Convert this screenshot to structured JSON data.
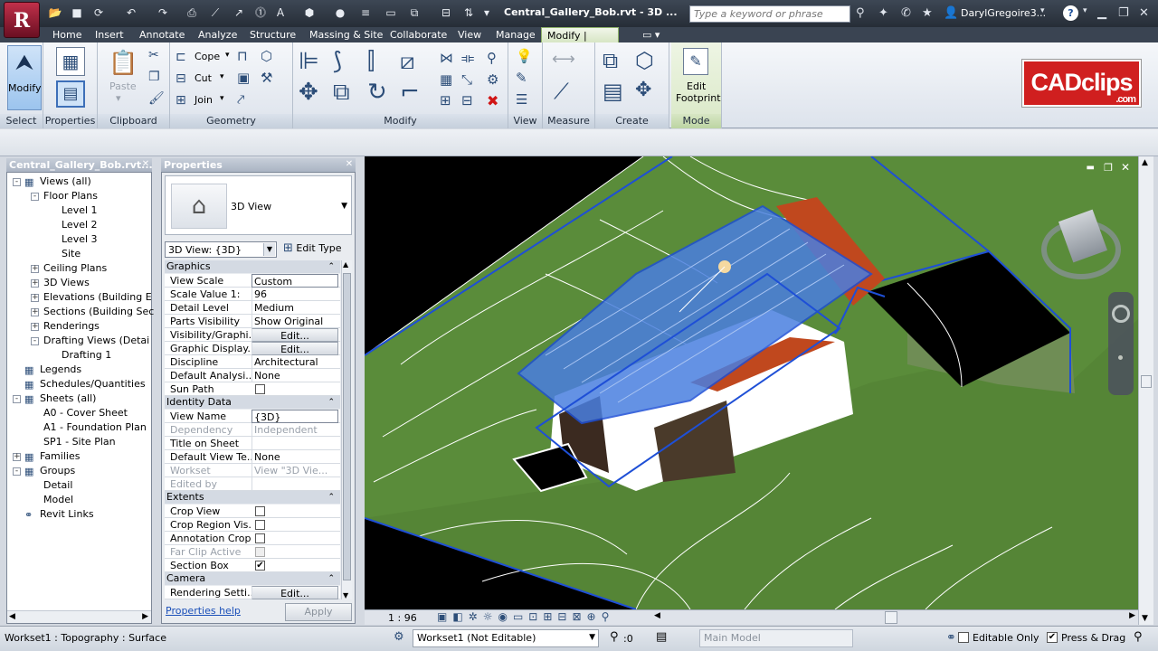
{
  "app": {
    "logo_letter": "R",
    "document_title": "Central_Gallery_Bob.rvt - 3D ...",
    "search_placeholder": "Type a keyword or phrase",
    "user": "DarylGregoire3..."
  },
  "ribbon": {
    "tabs": [
      "Home",
      "Insert",
      "Annotate",
      "Analyze",
      "Structure",
      "Massing & Site",
      "Collaborate",
      "View",
      "Manage",
      "Modify | Roofs"
    ],
    "active_tab": "Modify | Roofs",
    "panels": {
      "select": "Select",
      "properties": "Properties",
      "clipboard": "Clipboard",
      "geometry": "Geometry",
      "modify": "Modify",
      "view": "View",
      "measure": "Measure",
      "create": "Create",
      "mode": "Mode"
    },
    "modify_label": "Modify",
    "paste_label": "Paste",
    "cope_label": "Cope",
    "cut_label": "Cut",
    "join_label": "Join",
    "edit_footprint_line1": "Edit",
    "edit_footprint_line2": "Footprint"
  },
  "brand": {
    "name": "CADclips",
    "suffix": ".com",
    "color": "#d01f1f"
  },
  "project_browser": {
    "title": "Central_Gallery_Bob.rvt...",
    "items": [
      {
        "label": "Views (all)",
        "depth": 0,
        "exp": "-"
      },
      {
        "label": "Floor Plans",
        "depth": 1,
        "exp": "-"
      },
      {
        "label": "Level 1",
        "depth": 2,
        "exp": ""
      },
      {
        "label": "Level 2",
        "depth": 2,
        "exp": ""
      },
      {
        "label": "Level 3",
        "depth": 2,
        "exp": ""
      },
      {
        "label": "Site",
        "depth": 2,
        "exp": ""
      },
      {
        "label": "Ceiling Plans",
        "depth": 1,
        "exp": "+"
      },
      {
        "label": "3D Views",
        "depth": 1,
        "exp": "+"
      },
      {
        "label": "Elevations (Building E",
        "depth": 1,
        "exp": "+"
      },
      {
        "label": "Sections (Building Sec",
        "depth": 1,
        "exp": "+"
      },
      {
        "label": "Renderings",
        "depth": 1,
        "exp": "+"
      },
      {
        "label": "Drafting Views (Detai",
        "depth": 1,
        "exp": "-"
      },
      {
        "label": "Drafting 1",
        "depth": 2,
        "exp": ""
      },
      {
        "label": "Legends",
        "depth": 0,
        "exp": ""
      },
      {
        "label": "Schedules/Quantities",
        "depth": 0,
        "exp": ""
      },
      {
        "label": "Sheets (all)",
        "depth": 0,
        "exp": "-"
      },
      {
        "label": "A0 - Cover Sheet",
        "depth": 1,
        "exp": ""
      },
      {
        "label": "A1 - Foundation Plan",
        "depth": 1,
        "exp": ""
      },
      {
        "label": "SP1 - Site Plan",
        "depth": 1,
        "exp": ""
      },
      {
        "label": "Families",
        "depth": 0,
        "exp": "+"
      },
      {
        "label": "Groups",
        "depth": 0,
        "exp": "-"
      },
      {
        "label": "Detail",
        "depth": 1,
        "exp": ""
      },
      {
        "label": "Model",
        "depth": 1,
        "exp": ""
      },
      {
        "label": "Revit Links",
        "depth": 0,
        "exp": ""
      }
    ]
  },
  "properties": {
    "title": "Properties",
    "type_name": "3D View",
    "instance_selector": "3D View: {3D}",
    "edit_type": "Edit Type",
    "groups": {
      "graphics": "Graphics",
      "identity": "Identity Data",
      "extents": "Extents",
      "camera": "Camera"
    },
    "graphics_rows": [
      {
        "k": "View Scale",
        "v": "Custom",
        "kind": "field"
      },
      {
        "k": "Scale Value    1:",
        "v": "96",
        "kind": "text"
      },
      {
        "k": "Detail Level",
        "v": "Medium",
        "kind": "text"
      },
      {
        "k": "Parts Visibility",
        "v": "Show Original",
        "kind": "text"
      },
      {
        "k": "Visibility/Graphi...",
        "v": "Edit...",
        "kind": "button"
      },
      {
        "k": "Graphic Display...",
        "v": "Edit...",
        "kind": "button"
      },
      {
        "k": "Discipline",
        "v": "Architectural",
        "kind": "text"
      },
      {
        "k": "Default Analysi...",
        "v": "None",
        "kind": "text"
      },
      {
        "k": "Sun Path",
        "v": "",
        "kind": "check",
        "checked": false
      }
    ],
    "identity_rows": [
      {
        "k": "View Name",
        "v": "{3D}",
        "kind": "field"
      },
      {
        "k": "Dependency",
        "v": "Independent",
        "kind": "grey"
      },
      {
        "k": "Title on Sheet",
        "v": "",
        "kind": "text"
      },
      {
        "k": "Default View Te...",
        "v": "None",
        "kind": "text"
      },
      {
        "k": "Workset",
        "v": "View \"3D Vie...",
        "kind": "grey"
      },
      {
        "k": "Edited by",
        "v": "",
        "kind": "grey"
      }
    ],
    "extents_rows": [
      {
        "k": "Crop View",
        "v": "",
        "kind": "check",
        "checked": false
      },
      {
        "k": "Crop Region Vis...",
        "v": "",
        "kind": "check",
        "checked": false
      },
      {
        "k": "Annotation Crop",
        "v": "",
        "kind": "check",
        "checked": false
      },
      {
        "k": "Far Clip Active",
        "v": "",
        "kind": "greycheck",
        "checked": false
      },
      {
        "k": "Section Box",
        "v": "",
        "kind": "check",
        "checked": true
      }
    ],
    "camera_rows": [
      {
        "k": "Rendering Setti...",
        "v": "Edit...",
        "kind": "button"
      }
    ],
    "help_link": "Properties help",
    "apply": "Apply"
  },
  "viewport": {
    "scale": "1 : 96"
  },
  "status": {
    "text": "Workset1 : Topography : Surface",
    "workset": "Workset1 (Not Editable)",
    "filter_count": ":0",
    "model": "Main Model",
    "editable_only": "Editable Only",
    "press_drag": "Press & Drag"
  }
}
